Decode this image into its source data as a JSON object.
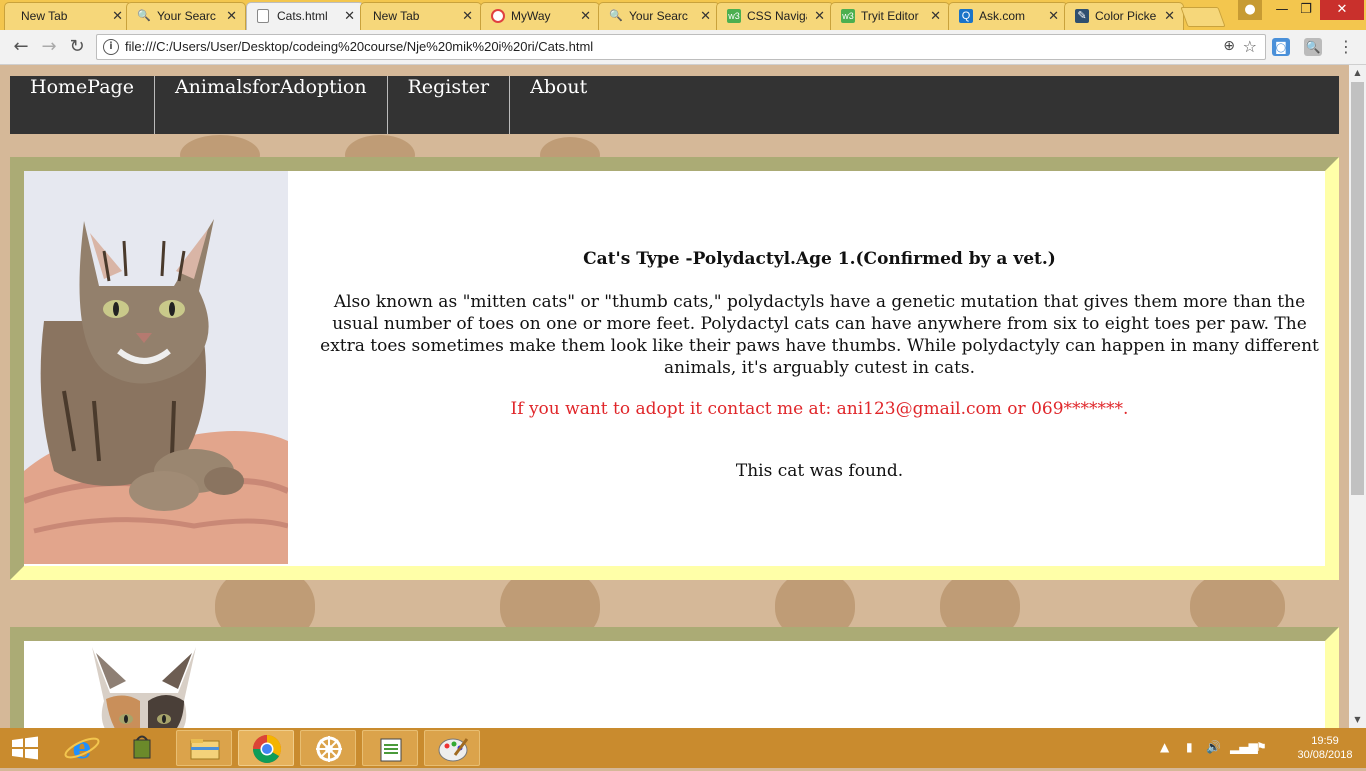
{
  "browser": {
    "tabs": [
      {
        "title": "New Tab",
        "icon": "blank-page-icon",
        "active": false
      },
      {
        "title": "Your Searc",
        "icon": "search-icon",
        "active": false
      },
      {
        "title": "Cats.html",
        "icon": "document-icon",
        "active": true
      },
      {
        "title": "New Tab",
        "icon": "blank-page-icon",
        "active": false
      },
      {
        "title": "MyWay",
        "icon": "myway-icon",
        "active": false
      },
      {
        "title": "Your Searc",
        "icon": "search-icon",
        "active": false
      },
      {
        "title": "CSS Naviga",
        "icon": "w3schools-icon",
        "active": false
      },
      {
        "title": "Tryit Editor",
        "icon": "w3schools-icon",
        "active": false
      },
      {
        "title": "Ask.com",
        "icon": "ask-icon",
        "active": false
      },
      {
        "title": "Color Picke",
        "icon": "color-picker-icon",
        "active": false
      }
    ],
    "url": "file:///C:/Users/User/Desktop/codeing%20course/Nje%20mik%20i%20ri/Cats.html",
    "tab_close_glyph": "✕"
  },
  "site": {
    "nav": [
      "HomePage",
      "AnimalsforAdoption",
      "Register",
      "About"
    ],
    "cats": [
      {
        "heading": "Cat's Type -Polydactyl.Age 1.(Confirmed by a vet.)",
        "description": "Also known as \"mitten cats\" or \"thumb cats,\" polydactyls have a genetic mutation that gives them more than the usual number of toes on one or more feet. Polydactyl cats can have anywhere from six to eight toes per paw. The extra toes sometimes make them look like their paws have thumbs. While polydactyly can happen in many different animals, it's arguably cutest in cats.",
        "contact": "If you want to adopt it contact me at: ani123@gmail.com or 069*******.",
        "status": "This cat was found."
      }
    ]
  },
  "taskbar": {
    "apps": [
      "start-icon",
      "internet-explorer-icon",
      "store-bag-icon",
      "file-explorer-icon",
      "chrome-icon",
      "settings-wheel-icon",
      "notepad-icon",
      "paint-icon"
    ],
    "time": "19:59",
    "date": "30/08/2018"
  },
  "colors": {
    "page_bg": "#d5b898",
    "nav_bg": "#333333",
    "card_border_dark": "#abab75",
    "card_border_light": "#ffffa8",
    "contact_text": "#e0262a",
    "taskbar": "#c98b2e",
    "tab_strip": "#f3c64e"
  }
}
